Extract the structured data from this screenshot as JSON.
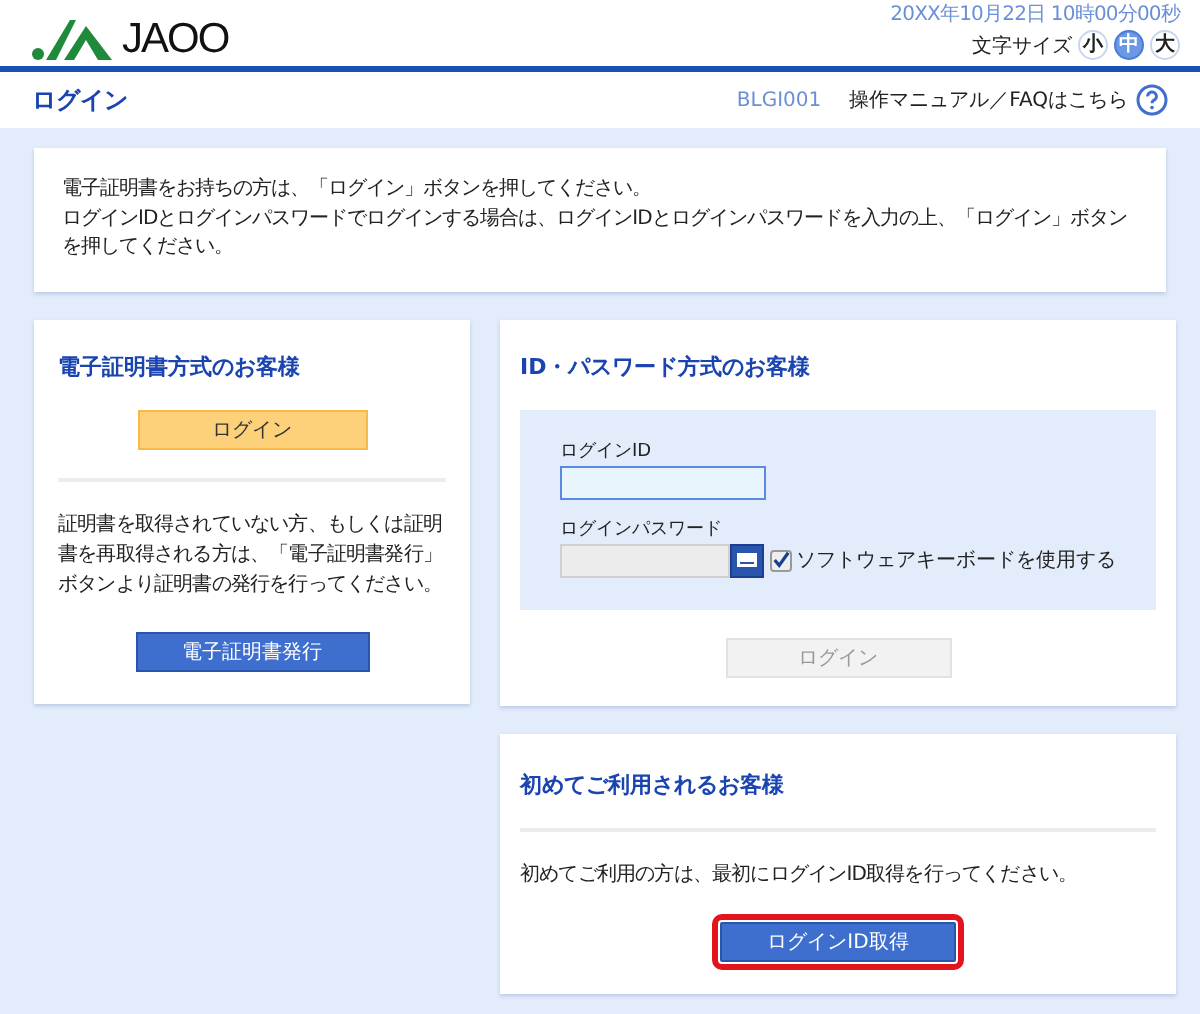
{
  "header": {
    "logo": "JAOO",
    "datetime": "20XX年10月22日 10時00分00秒",
    "font_size_label": "文字サイズ",
    "font_sizes": [
      {
        "label": "小",
        "selected": false
      },
      {
        "label": "中",
        "selected": true
      },
      {
        "label": "大",
        "selected": false
      }
    ]
  },
  "title_bar": {
    "title": "ログイン",
    "screen_id": "BLGI001",
    "help_link": "操作マニュアル／FAQはこちら"
  },
  "notice": [
    "電子証明書をお持ちの方は、「ログイン」ボタンを押してください。",
    "ログインIDとログインパスワードでログインする場合は、ログインIDとログインパスワードを入力の上、「ログイン」ボタンを押してください。"
  ],
  "certificate_panel": {
    "title": "電子証明書方式のお客様",
    "login_button": "ログイン",
    "description": "証明書を取得されていない方、もしくは証明書を再取得される方は、「電子証明書発行」ボタンより証明書の発行を行ってください。",
    "issue_button": "電子証明書発行"
  },
  "password_panel": {
    "title": "ID・パスワード方式のお客様",
    "id_label": "ログインID",
    "password_label": "ログインパスワード",
    "software_keyboard": {
      "label": "ソフトウェアキーボードを使用する",
      "checked": true
    },
    "login_button": {
      "label": "ログイン",
      "disabled": true
    }
  },
  "first_time_panel": {
    "title": "初めてご利用されるお客様",
    "description": "初めてご利用の方は、最初にログインID取得を行ってください。",
    "button": {
      "label": "ログインID取得",
      "highlighted": true
    }
  }
}
